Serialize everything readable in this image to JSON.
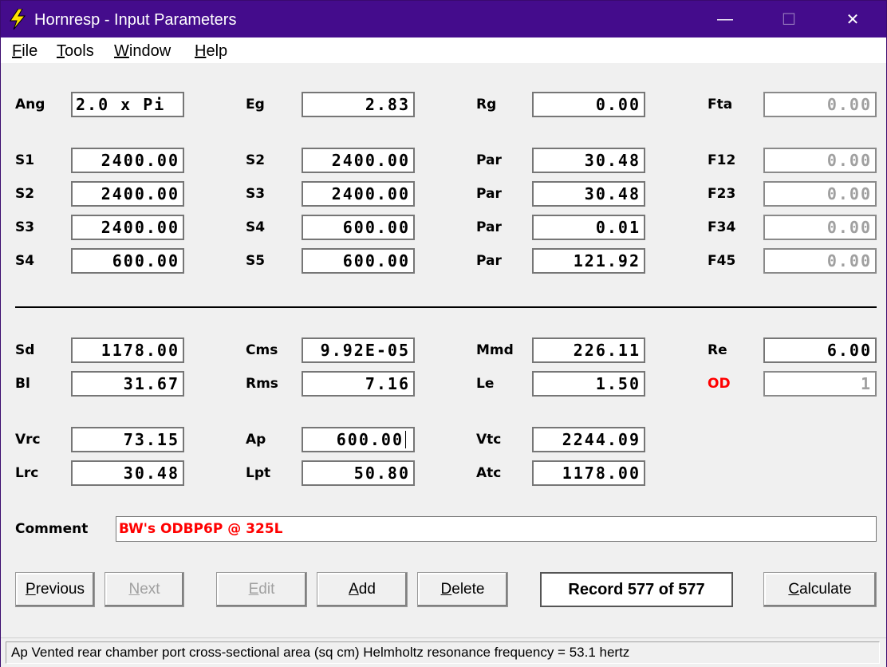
{
  "window": {
    "title": "Hornresp - Input Parameters",
    "controls": {
      "minimize": "—",
      "maximize": "☐",
      "close": "✕"
    }
  },
  "menu": [
    {
      "label": "File",
      "mnemonic": "F",
      "rest": "ile"
    },
    {
      "label": "Tools",
      "mnemonic": "T",
      "rest": "ools"
    },
    {
      "label": "Window",
      "mnemonic": "W",
      "rest": "indow"
    },
    {
      "label": "Help",
      "mnemonic": "H",
      "rest": "elp"
    }
  ],
  "params": {
    "ang": {
      "label": "Ang",
      "value": "2.0 x Pi"
    },
    "eg": {
      "label": "Eg",
      "value": "2.83"
    },
    "rg": {
      "label": "Rg",
      "value": "0.00"
    },
    "fta": {
      "label": "Fta",
      "value": "0.00"
    },
    "r1": {
      "a": {
        "label": "S1",
        "value": "2400.00"
      },
      "b": {
        "label": "S2",
        "value": "2400.00"
      },
      "c": {
        "label": "Par",
        "value": "30.48"
      },
      "d": {
        "label": "F12",
        "value": "0.00"
      }
    },
    "r2": {
      "a": {
        "label": "S2",
        "value": "2400.00"
      },
      "b": {
        "label": "S3",
        "value": "2400.00"
      },
      "c": {
        "label": "Par",
        "value": "30.48"
      },
      "d": {
        "label": "F23",
        "value": "0.00"
      }
    },
    "r3": {
      "a": {
        "label": "S3",
        "value": "2400.00"
      },
      "b": {
        "label": "S4",
        "value": "600.00"
      },
      "c": {
        "label": "Par",
        "value": "0.01"
      },
      "d": {
        "label": "F34",
        "value": "0.00"
      }
    },
    "r4": {
      "a": {
        "label": "S4",
        "value": "600.00"
      },
      "b": {
        "label": "S5",
        "value": "600.00"
      },
      "c": {
        "label": "Par",
        "value": "121.92"
      },
      "d": {
        "label": "F45",
        "value": "0.00"
      }
    }
  },
  "driver": {
    "sd": {
      "label": "Sd",
      "value": "1178.00"
    },
    "cms": {
      "label": "Cms",
      "value": "9.92E-05"
    },
    "mmd": {
      "label": "Mmd",
      "value": "226.11"
    },
    "re": {
      "label": "Re",
      "value": "6.00"
    },
    "bl": {
      "label": "Bl",
      "value": "31.67"
    },
    "rms": {
      "label": "Rms",
      "value": "7.16"
    },
    "le": {
      "label": "Le",
      "value": "1.50"
    },
    "od": {
      "label": "OD",
      "value": "1",
      "label_color": "#ff0000"
    }
  },
  "chamber": {
    "vrc": {
      "label": "Vrc",
      "value": "73.15"
    },
    "ap": {
      "label": "Ap",
      "value": "600.00"
    },
    "vtc": {
      "label": "Vtc",
      "value": "2244.09"
    },
    "lrc": {
      "label": "Lrc",
      "value": "30.48"
    },
    "lpt": {
      "label": "Lpt",
      "value": "50.80"
    },
    "atc": {
      "label": "Atc",
      "value": "1178.00"
    }
  },
  "comment": {
    "label": "Comment",
    "value": "BW's ODBP6P @ 325L"
  },
  "buttons": {
    "previous": {
      "mnemonic": "P",
      "rest": "revious"
    },
    "next": {
      "mnemonic": "N",
      "rest": "ext"
    },
    "edit": {
      "mnemonic": "E",
      "rest": "dit"
    },
    "add": {
      "mnemonic": "A",
      "rest": "dd"
    },
    "delete": {
      "mnemonic": "D",
      "rest": "elete"
    },
    "calculate": {
      "mnemonic": "C",
      "rest": "alculate"
    }
  },
  "record": "Record 577 of 577",
  "status": "Ap   Vented rear chamber port cross-sectional area  (sq cm)   Helmholtz resonance frequency = 53.1 hertz",
  "colors": {
    "titlebar": "#440c8c",
    "icon": "#ffe000",
    "od_label": "#ff0000",
    "comment_text": "#ff0000"
  }
}
